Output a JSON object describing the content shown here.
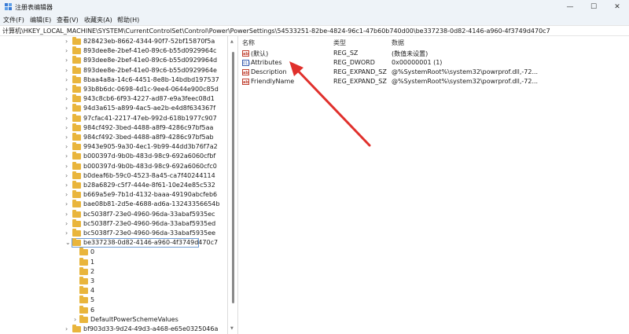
{
  "window": {
    "title": "注册表编辑器",
    "controls": {
      "minimize": "—",
      "maximize": "☐",
      "close": "✕"
    }
  },
  "menu": [
    "文件(F)",
    "编辑(E)",
    "查看(V)",
    "收藏夹(A)",
    "帮助(H)"
  ],
  "address": "计算机\\HKEY_LOCAL_MACHINE\\SYSTEM\\CurrentControlSet\\Control\\Power\\PowerSettings\\54533251-82be-4824-96c1-47b60b740d00\\be337238-0d82-4146-a960-4f3749d470c7",
  "tree": {
    "keys": [
      "828423eb-8662-4344-90f7-52bf15870f5a",
      "893dee8e-2bef-41e0-89c6-b55d0929964c",
      "893dee8e-2bef-41e0-89c6-b55d0929964d",
      "893dee8e-2bef-41e0-89c6-b55d0929964e",
      "8baa4a8a-14c6-4451-8e8b-14bdbd197537",
      "93b8b6dc-0698-4d1c-9ee4-0644e900c85d",
      "943c8cb6-6f93-4227-ad87-e9a3feec08d1",
      "94d3a615-a899-4ac5-ae2b-e4d8f634367f",
      "97cfac41-2217-47eb-992d-618b1977c907",
      "984cf492-3bed-4488-a8f9-4286c97bf5aa",
      "984cf492-3bed-4488-a8f9-4286c97bf5ab",
      "9943e905-9a30-4ec1-9b99-44dd3b76f7a2",
      "b000397d-9b0b-483d-98c9-692a6060cfbf",
      "b000397d-9b0b-483d-98c9-692a6060cfc0",
      "b0deaf6b-59c0-4523-8a45-ca7f40244114",
      "b28a6829-c5f7-444e-8f61-10e24e85c532",
      "b669a5e9-7b1d-4132-baaa-49190abcfeb6",
      "bae08b81-2d5e-4688-ad6a-13243356654b",
      "bc5038f7-23e0-4960-96da-33abaf5935ec",
      "bc5038f7-23e0-4960-96da-33abaf5935ed",
      "bc5038f7-23e0-4960-96da-33abaf5935ee"
    ],
    "selected": "be337238-0d82-4146-a960-4f3749d470c7",
    "children": [
      "0",
      "1",
      "2",
      "3",
      "4",
      "5",
      "6",
      "DefaultPowerSchemeValues"
    ],
    "next": "bf903d33-9d24-49d3-a468-e65e0325046a"
  },
  "values": {
    "headers": {
      "name": "名称",
      "type": "类型",
      "data": "数据"
    },
    "rows": [
      {
        "name": "(默认)",
        "type": "REG_SZ",
        "data": "(数值未设置)",
        "icon": "string-value-icon"
      },
      {
        "name": "Attributes",
        "type": "REG_DWORD",
        "data": "0x00000001 (1)",
        "icon": "dword-value-icon"
      },
      {
        "name": "Description",
        "type": "REG_EXPAND_SZ",
        "data": "@%SystemRoot%\\system32\\powrprof.dll,-72...",
        "icon": "string-value-icon"
      },
      {
        "name": "FriendlyName",
        "type": "REG_EXPAND_SZ",
        "data": "@%SystemRoot%\\system32\\powrprof.dll,-72...",
        "icon": "string-value-icon"
      }
    ]
  },
  "colors": {
    "titlebar": "#eef3f8",
    "folder": "#e9b53c",
    "selection_border": "#6e9bd3",
    "annotation_arrow": "#e0302c"
  }
}
